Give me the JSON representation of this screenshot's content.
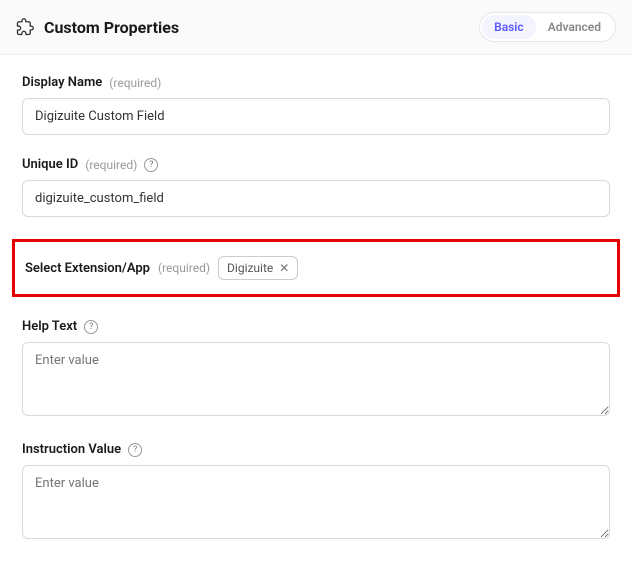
{
  "header": {
    "title": "Custom Properties",
    "tabs": {
      "basic": "Basic",
      "advanced": "Advanced"
    }
  },
  "labels": {
    "required": "(required)"
  },
  "fields": {
    "display_name": {
      "label": "Display Name",
      "value": "Digizuite Custom Field"
    },
    "unique_id": {
      "label": "Unique ID",
      "value": "digizuite_custom_field"
    },
    "select_extension": {
      "label": "Select Extension/App",
      "chip": "Digizuite"
    },
    "help_text": {
      "label": "Help Text",
      "placeholder": "Enter value",
      "value": ""
    },
    "instruction_value": {
      "label": "Instruction Value",
      "placeholder": "Enter value",
      "value": ""
    }
  }
}
